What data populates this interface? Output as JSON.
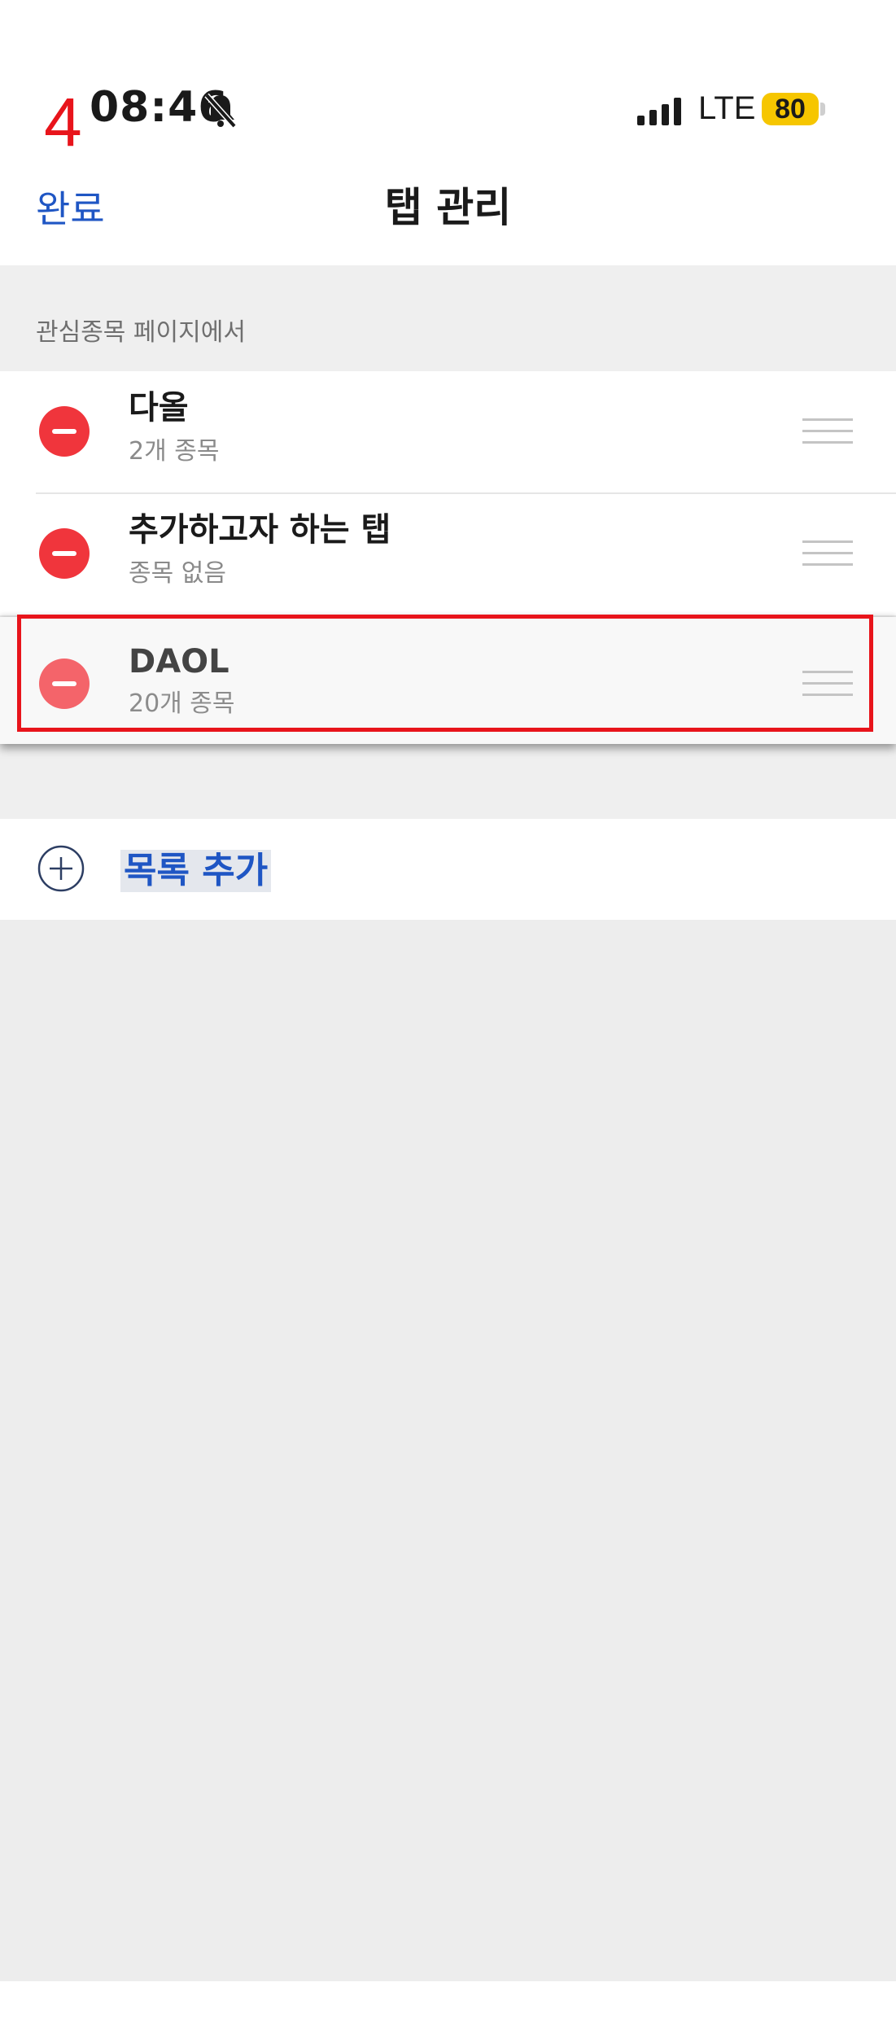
{
  "status_bar": {
    "step_number": "4",
    "time": "08:46",
    "network": "LTE",
    "battery": "80",
    "icons": [
      "bell-slash-icon",
      "signal-icon"
    ]
  },
  "nav": {
    "done_label": "완료",
    "title": "탭 관리"
  },
  "section": {
    "header": "관심종목 페이지에서"
  },
  "tabs": [
    {
      "title": "다올",
      "subtitle": "2개 종목"
    },
    {
      "title": "추가하고자 하는 탭",
      "subtitle": "종목 없음"
    },
    {
      "title": "DAOL",
      "subtitle": "20개 종목"
    }
  ],
  "add_row": {
    "label": "목록 추가"
  },
  "colors": {
    "accent": "#1f56c4",
    "delete_red": "#f0353c",
    "highlight_red": "#e8141b",
    "battery_yellow": "#f6c600"
  }
}
